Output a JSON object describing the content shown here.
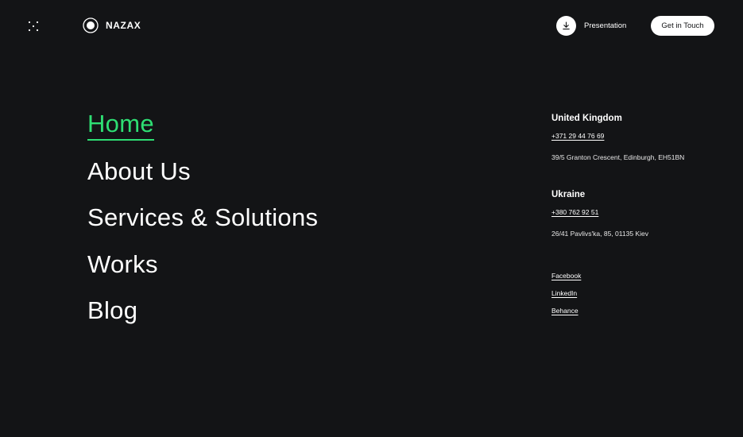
{
  "header": {
    "menu_icon": "dots-grid-icon",
    "logo_text": "NAZAX",
    "presentation_label": "Presentation",
    "cta_label": "Get in Touch"
  },
  "nav": {
    "items": [
      {
        "label": "Home",
        "active": true
      },
      {
        "label": "About Us",
        "active": false
      },
      {
        "label": "Services & Solutions",
        "active": false
      },
      {
        "label": "Works",
        "active": false
      },
      {
        "label": "Blog",
        "active": false
      }
    ]
  },
  "contacts": {
    "offices": [
      {
        "country": "United Kingdom",
        "phone": "+371 29 44 76 69",
        "address": "39/5 Granton Crescent, Edinburgh, EH51BN"
      },
      {
        "country": "Ukraine",
        "phone": "+380 762 92 51",
        "address": "26/41 Pavlivs'ka, 85, 01135 Kiev"
      }
    ],
    "socials": [
      "Facebook",
      "LinkedIn",
      "Behance"
    ]
  },
  "colors": {
    "background": "#131416",
    "accent": "#2ede73",
    "text": "#ffffff"
  }
}
